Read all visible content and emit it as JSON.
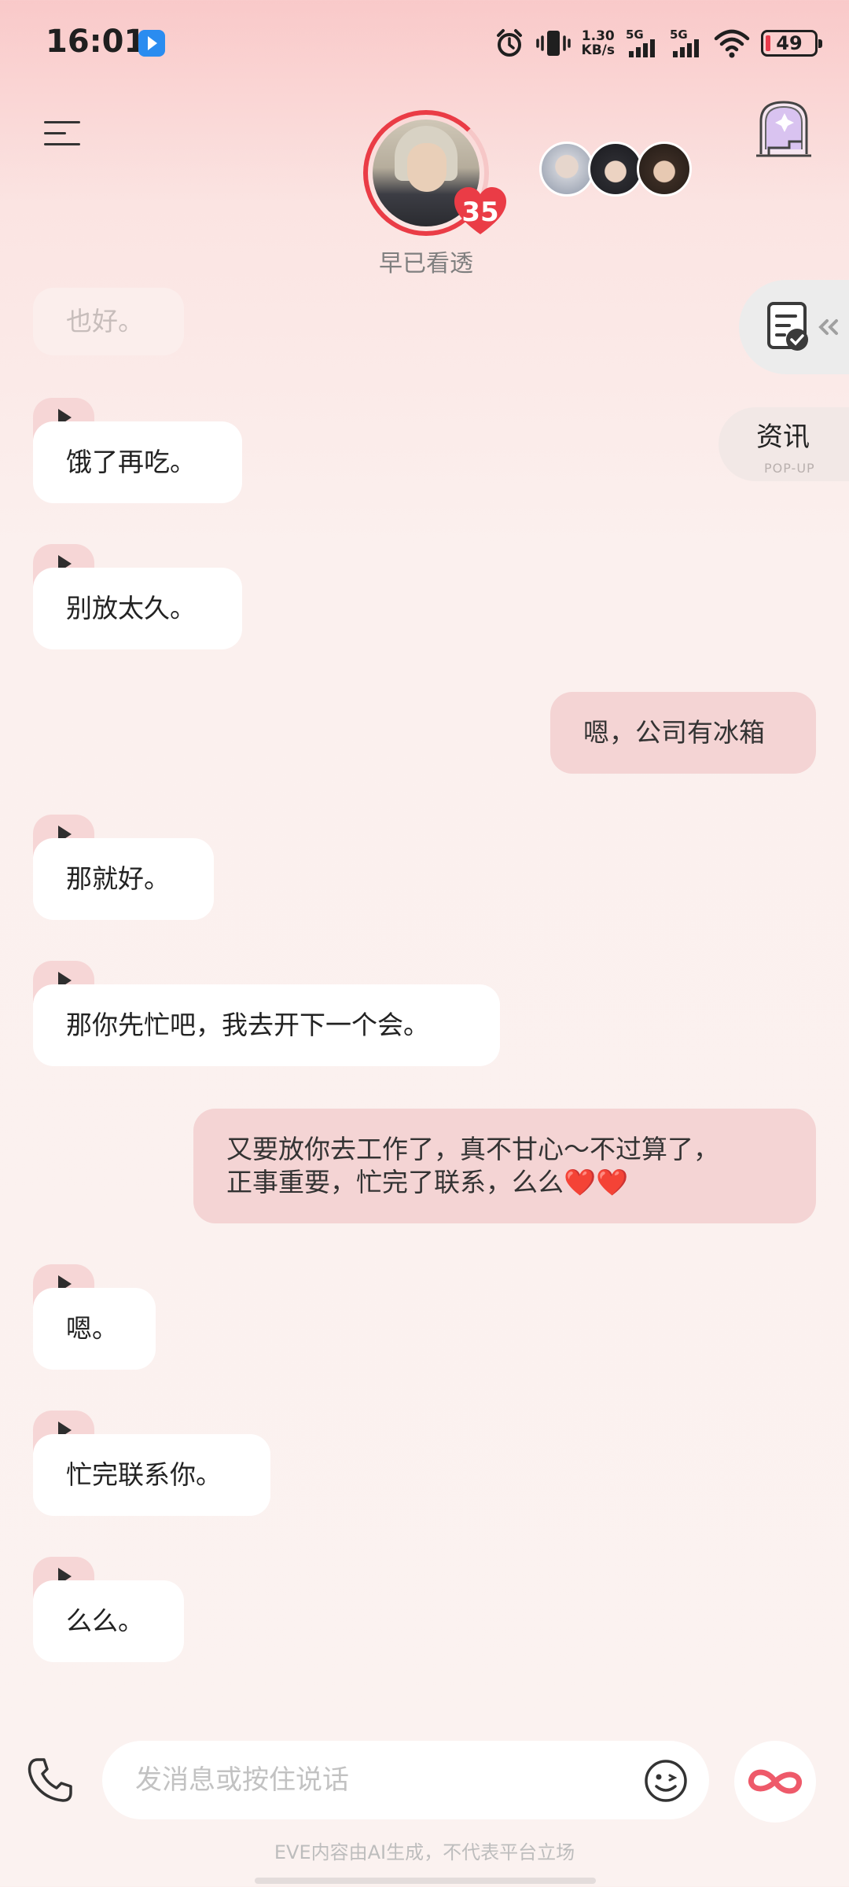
{
  "status_bar": {
    "time": "16:01",
    "net_speed_value": "1.30",
    "net_speed_unit": "KB/s",
    "sim1_label": "5G",
    "sim2_label": "5G",
    "battery": "49",
    "icons": [
      "alarm-icon",
      "vibrate-icon",
      "signal-icon",
      "wifi-icon",
      "battery-icon"
    ]
  },
  "header": {
    "affection_level": "35",
    "character_status": "早已看透",
    "other_characters_count": 3
  },
  "side": {
    "news_label": "资讯",
    "news_sub": "POP-UP"
  },
  "messages": [
    {
      "role": "ai",
      "text": "也好。",
      "faded": true
    },
    {
      "role": "ai",
      "text": "饿了再吃。"
    },
    {
      "role": "ai",
      "text": "别放太久。"
    },
    {
      "role": "user",
      "text": "嗯，公司有冰箱"
    },
    {
      "role": "ai",
      "text": "那就好。"
    },
    {
      "role": "ai",
      "text": "那你先忙吧，我去开下一个会。"
    },
    {
      "role": "user",
      "text": "又要放你去工作了，真不甘心～不过算了，\n正事重要，忙完了联系，么么❤️❤️"
    },
    {
      "role": "ai",
      "text": "嗯。"
    },
    {
      "role": "ai",
      "text": "忙完联系你。"
    },
    {
      "role": "ai",
      "text": "么么。"
    }
  ],
  "composer": {
    "placeholder": "发消息或按住说话"
  },
  "footer": {
    "disclaimer": "EVE内容由AI生成，不代表平台立场"
  },
  "colors": {
    "accent": "#ea3c46",
    "user_bubble": "#f4d4d4",
    "ai_bubble": "#ffffff"
  }
}
